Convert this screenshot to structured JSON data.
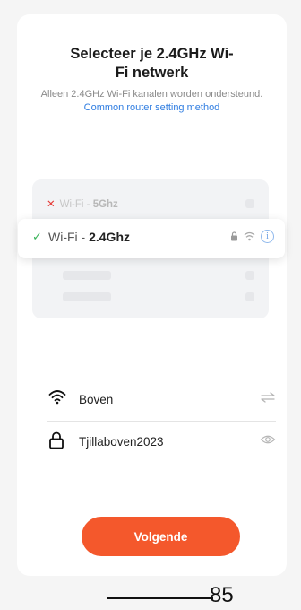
{
  "title": "Selecteer je 2.4GHz Wi-\nFi netwerk",
  "title_line1": "Selecteer je 2.4GHz Wi-",
  "title_line2": "Fi netwerk",
  "subtitle_text": "Alleen 2.4GHz Wi-Fi kanalen worden ondersteund.",
  "subtitle_link": "Common router setting method",
  "illustration": {
    "row_5g_prefix": "Wi-Fi - ",
    "row_5g_band": "5Ghz",
    "row_24_prefix": "Wi-Fi - ",
    "row_24_band": "2.4Ghz"
  },
  "wifi_field": {
    "value": "Boven",
    "icon": "wifi-icon",
    "action_icon": "swap-icon"
  },
  "password_field": {
    "value": "Tjillaboven2023",
    "icon": "lock-icon",
    "action_icon": "eye-icon"
  },
  "next_button": "Volgende",
  "page_number": "85",
  "colors": {
    "accent": "#f4582c",
    "link": "#2f7de1",
    "check": "#3ab45a",
    "error": "#e53935"
  }
}
